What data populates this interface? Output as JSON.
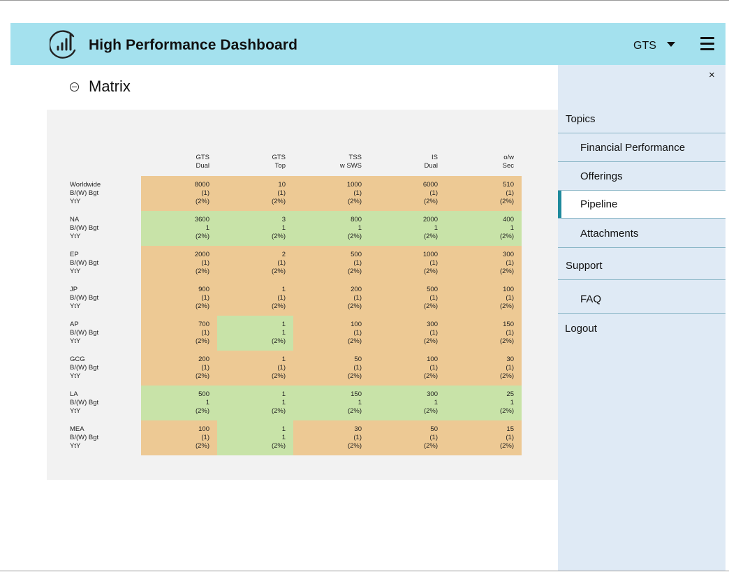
{
  "header": {
    "title": "High Performance Dashboard",
    "org_selected": "GTS",
    "icons": [
      "chart-logo-icon",
      "caret-down-icon",
      "hamburger-menu-icon"
    ]
  },
  "matrix": {
    "title": "Matrix",
    "columns": [
      {
        "line1": "GTS",
        "line2": "Dual"
      },
      {
        "line1": "GTS",
        "line2": "Top"
      },
      {
        "line1": "TSS",
        "line2": "w SWS"
      },
      {
        "line1": "IS",
        "line2": "Dual"
      },
      {
        "line1": "o/w",
        "line2": "Sec"
      }
    ],
    "row_metric_labels": [
      "B/(W) Bgt",
      "YtY"
    ],
    "rows": [
      {
        "name": "Worldwide",
        "cells": [
          {
            "value": "8000",
            "bgt": "(1)",
            "yty": "(2%)",
            "status": "orange"
          },
          {
            "value": "10",
            "bgt": "(1)",
            "yty": "(2%)",
            "status": "orange"
          },
          {
            "value": "1000",
            "bgt": "(1)",
            "yty": "(2%)",
            "status": "orange"
          },
          {
            "value": "6000",
            "bgt": "(1)",
            "yty": "(2%)",
            "status": "orange"
          },
          {
            "value": "510",
            "bgt": "(1)",
            "yty": "(2%)",
            "status": "orange"
          }
        ]
      },
      {
        "name": "NA",
        "cells": [
          {
            "value": "3600",
            "bgt": "1",
            "yty": "(2%)",
            "status": "green"
          },
          {
            "value": "3",
            "bgt": "1",
            "yty": "(2%)",
            "status": "green"
          },
          {
            "value": "800",
            "bgt": "1",
            "yty": "(2%)",
            "status": "green"
          },
          {
            "value": "2000",
            "bgt": "1",
            "yty": "(2%)",
            "status": "green"
          },
          {
            "value": "400",
            "bgt": "1",
            "yty": "(2%)",
            "status": "green"
          }
        ]
      },
      {
        "name": "EP",
        "cells": [
          {
            "value": "2000",
            "bgt": "(1)",
            "yty": "(2%)",
            "status": "orange"
          },
          {
            "value": "2",
            "bgt": "(1)",
            "yty": "(2%)",
            "status": "orange"
          },
          {
            "value": "500",
            "bgt": "(1)",
            "yty": "(2%)",
            "status": "orange"
          },
          {
            "value": "1000",
            "bgt": "(1)",
            "yty": "(2%)",
            "status": "orange"
          },
          {
            "value": "300",
            "bgt": "(1)",
            "yty": "(2%)",
            "status": "orange"
          }
        ]
      },
      {
        "name": "JP",
        "cells": [
          {
            "value": "900",
            "bgt": "(1)",
            "yty": "(2%)",
            "status": "orange"
          },
          {
            "value": "1",
            "bgt": "(1)",
            "yty": "(2%)",
            "status": "orange"
          },
          {
            "value": "200",
            "bgt": "(1)",
            "yty": "(2%)",
            "status": "orange"
          },
          {
            "value": "500",
            "bgt": "(1)",
            "yty": "(2%)",
            "status": "orange"
          },
          {
            "value": "100",
            "bgt": "(1)",
            "yty": "(2%)",
            "status": "orange"
          }
        ]
      },
      {
        "name": "AP",
        "cells": [
          {
            "value": "700",
            "bgt": "(1)",
            "yty": "(2%)",
            "status": "orange"
          },
          {
            "value": "1",
            "bgt": "1",
            "yty": "(2%)",
            "status": "green"
          },
          {
            "value": "100",
            "bgt": "(1)",
            "yty": "(2%)",
            "status": "orange"
          },
          {
            "value": "300",
            "bgt": "(1)",
            "yty": "(2%)",
            "status": "orange"
          },
          {
            "value": "150",
            "bgt": "(1)",
            "yty": "(2%)",
            "status": "orange"
          }
        ]
      },
      {
        "name": "GCG",
        "cells": [
          {
            "value": "200",
            "bgt": "(1)",
            "yty": "(2%)",
            "status": "orange"
          },
          {
            "value": "1",
            "bgt": "(1)",
            "yty": "(2%)",
            "status": "orange"
          },
          {
            "value": "50",
            "bgt": "(1)",
            "yty": "(2%)",
            "status": "orange"
          },
          {
            "value": "100",
            "bgt": "(1)",
            "yty": "(2%)",
            "status": "orange"
          },
          {
            "value": "30",
            "bgt": "(1)",
            "yty": "(2%)",
            "status": "orange"
          }
        ]
      },
      {
        "name": "LA",
        "cells": [
          {
            "value": "500",
            "bgt": "1",
            "yty": "(2%)",
            "status": "green"
          },
          {
            "value": "1",
            "bgt": "1",
            "yty": "(2%)",
            "status": "green"
          },
          {
            "value": "150",
            "bgt": "1",
            "yty": "(2%)",
            "status": "green"
          },
          {
            "value": "300",
            "bgt": "1",
            "yty": "(2%)",
            "status": "green"
          },
          {
            "value": "25",
            "bgt": "1",
            "yty": "(2%)",
            "status": "green"
          }
        ]
      },
      {
        "name": "MEA",
        "cells": [
          {
            "value": "100",
            "bgt": "(1)",
            "yty": "(2%)",
            "status": "orange"
          },
          {
            "value": "1",
            "bgt": "1",
            "yty": "(2%)",
            "status": "green"
          },
          {
            "value": "30",
            "bgt": "(1)",
            "yty": "(2%)",
            "status": "orange"
          },
          {
            "value": "50",
            "bgt": "(1)",
            "yty": "(2%)",
            "status": "orange"
          },
          {
            "value": "15",
            "bgt": "(1)",
            "yty": "(2%)",
            "status": "orange"
          }
        ]
      }
    ]
  },
  "side_menu": {
    "close_label": "×",
    "topics_label": "Topics",
    "items": [
      "Financial Performance",
      "Offerings",
      "Pipeline",
      "Attachments"
    ],
    "active_item": "Pipeline",
    "support_label": "Support",
    "faq_label": "FAQ",
    "logout_label": "Logout"
  },
  "colors": {
    "header_bg": "#a4e1ee",
    "below_budget": "#edc994",
    "above_budget": "#c8e3a8",
    "side_panel_bg": "#dfeaf5",
    "active_accent": "#1e8a9c"
  }
}
